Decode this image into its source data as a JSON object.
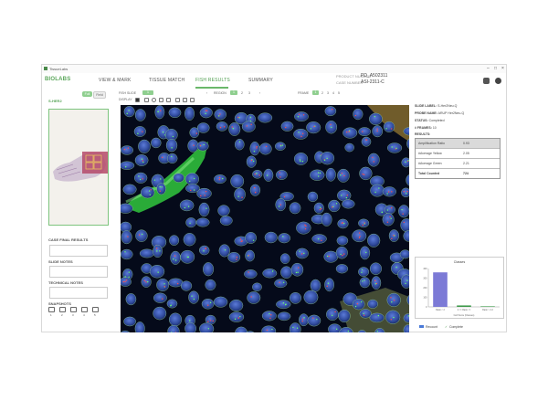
{
  "window": {
    "title": "TissueLabs"
  },
  "header": {
    "logo": "BIOLABS",
    "tabs": [
      "VIEW & MARK",
      "TISSUE MATCH",
      "FISH RESULTS",
      "SUMMARY"
    ],
    "active_tab_index": 2,
    "case_info": {
      "product_label": "PRODUCT NUMBER",
      "product_value": "PD_A502311",
      "case_label": "CASE NUMBER",
      "case_value": "ASI-2311-C"
    }
  },
  "left": {
    "title": "S-HER2",
    "toggle_a": "Full",
    "toggle_b": "Field",
    "case_final_results_label": "CASE FINAL RESULTS",
    "slide_notes_label": "SLIDE NOTES",
    "technical_notes_label": "TECHNICAL NOTES",
    "snapshots_label": "SNAPSHOTS",
    "snapshot_numbers": [
      "1",
      "2",
      "3",
      "4",
      "5"
    ]
  },
  "toolbar": {
    "fish_slide_label": "FISH SLIDE",
    "fish_slide_value": "1",
    "display_label": "DISPLAY",
    "region_label": "REGION",
    "region_values": [
      "1",
      "2",
      "3"
    ],
    "frame_label": "FRAME",
    "frame_values": [
      "1",
      "2",
      "3",
      "4",
      "5"
    ]
  },
  "right": {
    "slide_label_k": "SLIDE LABEL:",
    "slide_label_v": "S-Her2Neu.Q",
    "probe_name_k": "PROBE NAME:",
    "probe_name_v": "ARUP Her2Neu-Q",
    "status_k": "STATUS:",
    "status_v": "Completed",
    "frames_k": "# FRAMES:",
    "frames_v": "10",
    "results_label": "RESULTS:",
    "results": [
      {
        "k": "Amplification Ratio",
        "v": "0.93"
      },
      {
        "k": "#Average Yellow",
        "v": "2.05"
      },
      {
        "k": "#Average Green",
        "v": "2.21"
      },
      {
        "k": "Total Counted",
        "v": "724"
      }
    ],
    "legend_accept": "Recount",
    "legend_complete": "Complete"
  },
  "colors": {
    "accent": "#6ab86a",
    "viewer_bg": "#050a1a",
    "nucleus": "#3b5ab5",
    "tissue_green": "#3ddc4a"
  },
  "chart_data": {
    "type": "bar",
    "title": "Classes",
    "categories": [
      "Ratio < 2",
      "2 <= Ratio <=",
      "Ratio > 2.2"
    ],
    "values": [
      360,
      15,
      5
    ],
    "ylim": [
      0,
      400
    ],
    "yticks": [
      "400",
      "300",
      "200",
      "100",
      "0"
    ],
    "xlabel": "Cell Score (Classes)"
  }
}
